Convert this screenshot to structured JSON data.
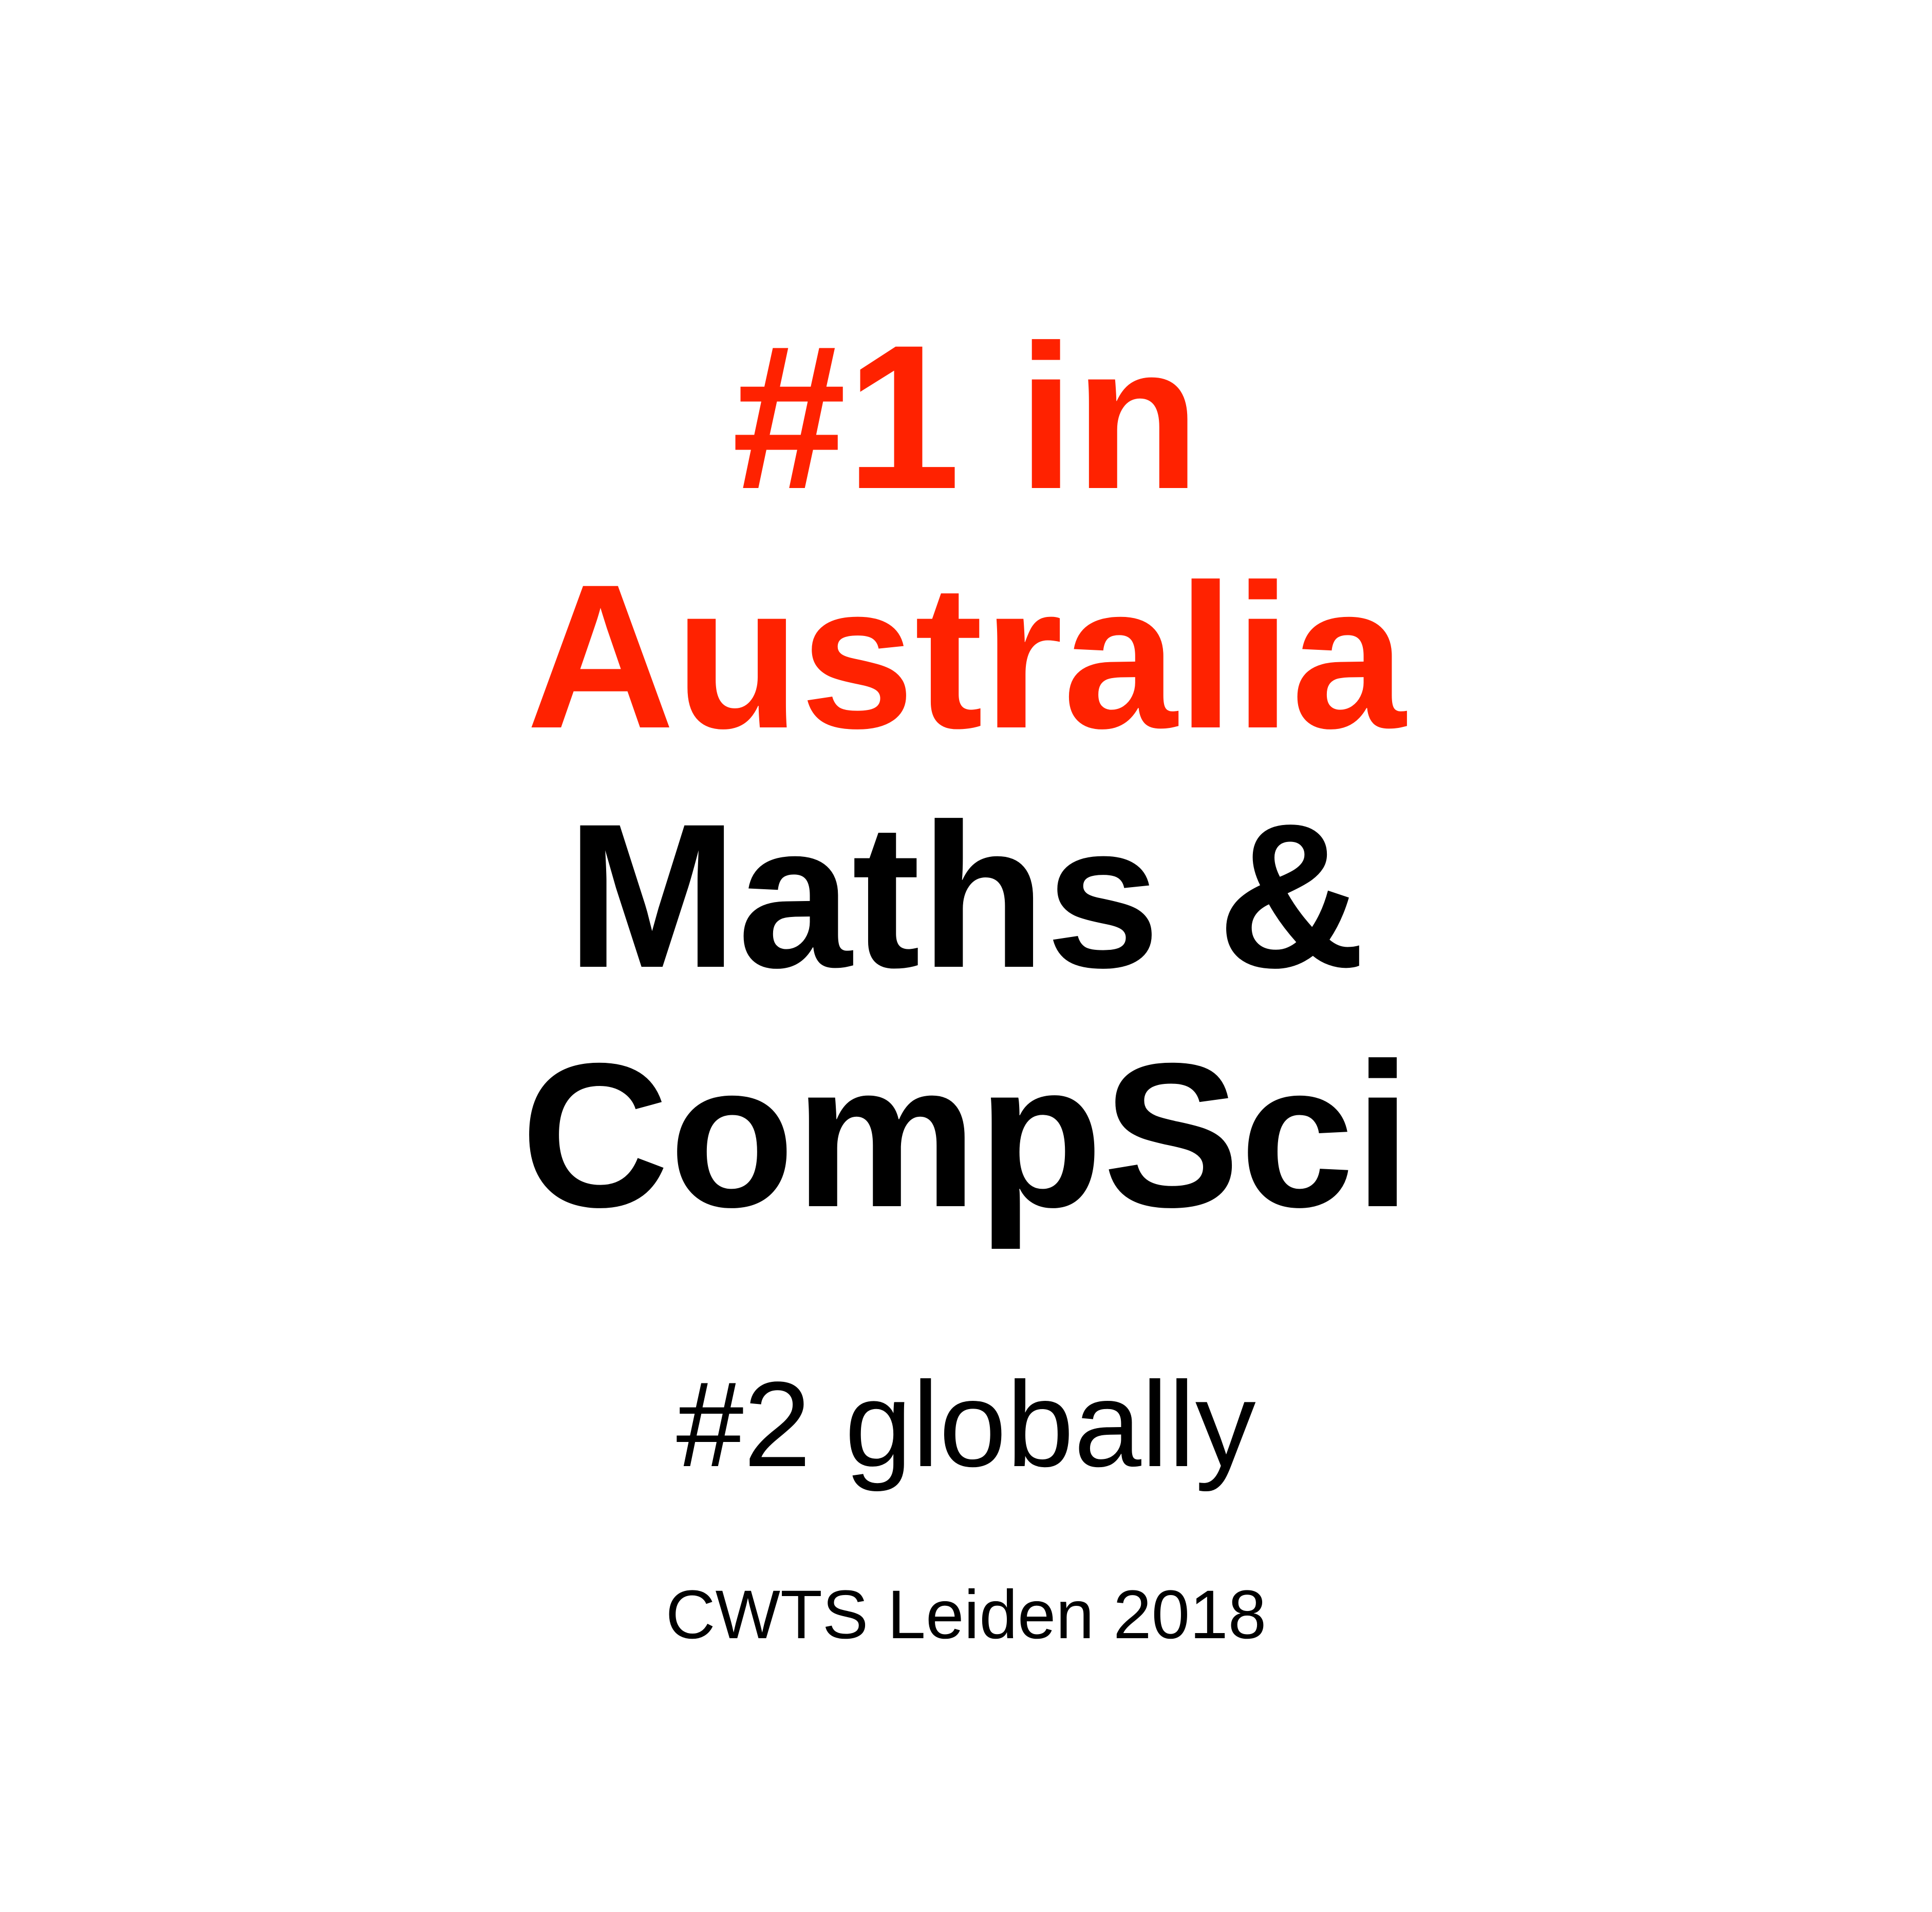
{
  "headline": {
    "rank_line": "#1 in",
    "region": "Australia",
    "field_line1": "Maths &",
    "field_line2": "CompSci"
  },
  "subheadline": "#2 globally",
  "source": "CWTS Leiden 2018",
  "colors": {
    "accent": "#ff2200",
    "text": "#000000",
    "background": "#ffffff"
  }
}
